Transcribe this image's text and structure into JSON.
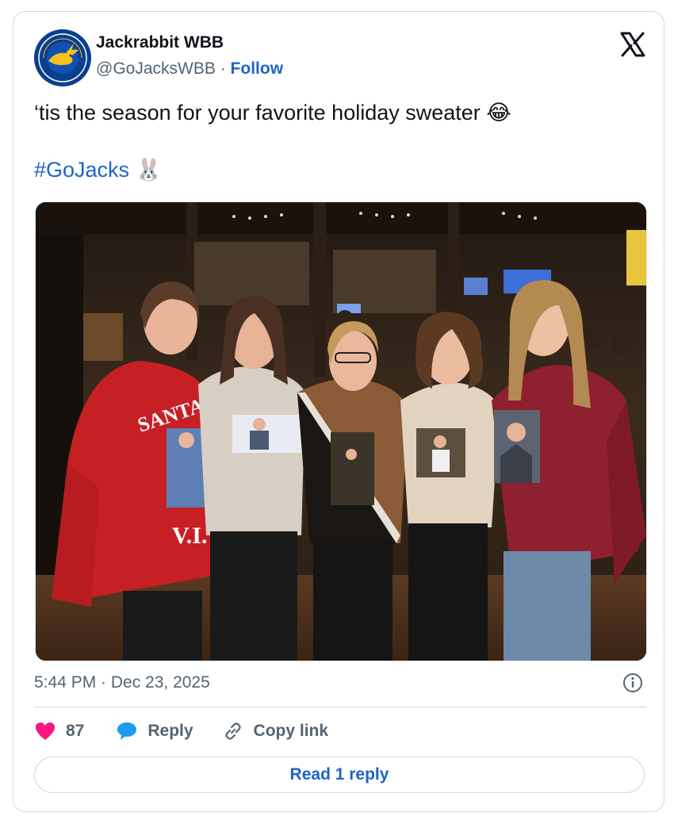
{
  "author": {
    "display_name": "Jackrabbit WBB",
    "handle": "@GoJacksWBB",
    "separator": "·",
    "follow_label": "Follow"
  },
  "tweet": {
    "text": "‘tis the season for your favorite holiday sweater",
    "text_emoji": "😂",
    "hashtag": "#GoJacks",
    "hashtag_emoji": "🐰",
    "timestamp": "5:44 PM · Dec 23, 2025"
  },
  "photo": {
    "sweater_text_1": "SANTA",
    "sweater_text_2": "V.I."
  },
  "actions": {
    "like_count": "87",
    "reply_label": "Reply",
    "copy_link_label": "Copy link"
  },
  "read_reply_label": "Read 1 reply",
  "colors": {
    "accent_blue": "#1d64c8",
    "like_pink": "#f91880",
    "reply_blue": "#1d9bf0",
    "muted_gray": "#536471",
    "border": "#cfd9de"
  },
  "icons": {
    "platform": "x-logo-icon",
    "info": "info-icon",
    "like": "heart-icon",
    "reply": "speech-bubble-icon",
    "copy_link": "link-icon"
  }
}
